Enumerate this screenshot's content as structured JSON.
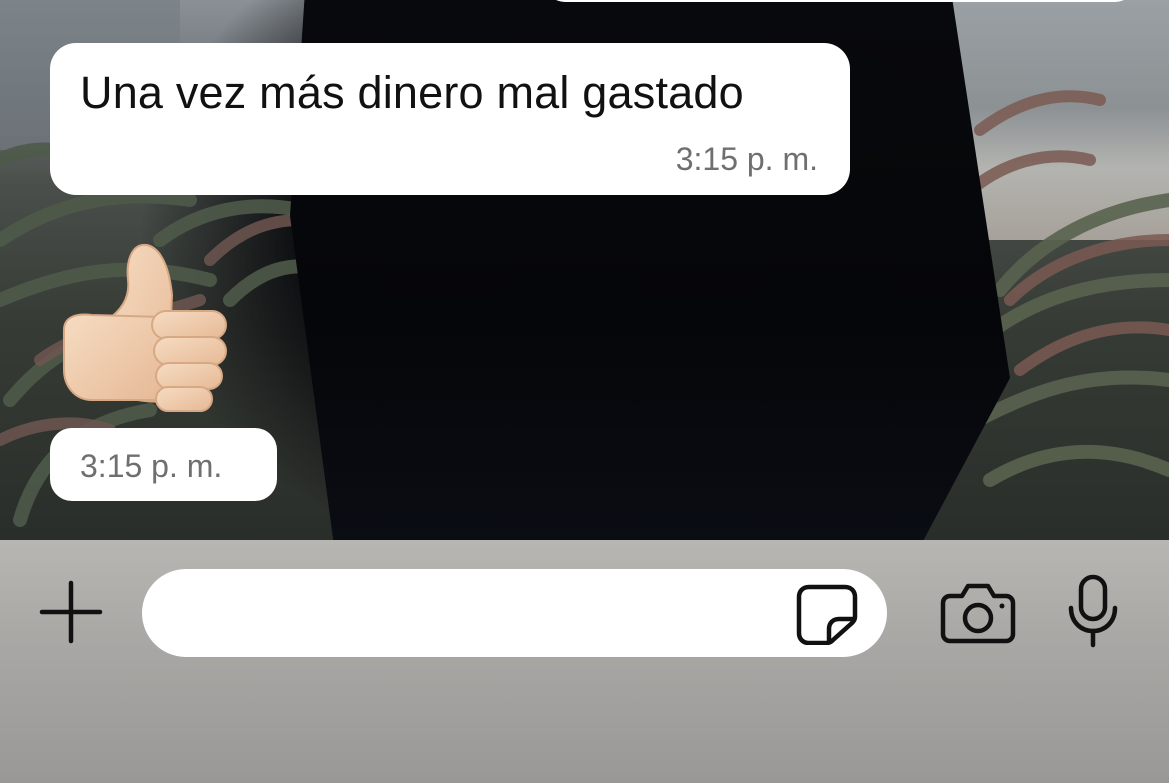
{
  "chat": {
    "messages": [
      {
        "type": "text",
        "text": "Una vez más dinero mal gastado",
        "time": "3:15 p. m."
      },
      {
        "type": "emoji",
        "emoji": "thumbs-up-light-skin-tone",
        "time": "3:15 p. m."
      }
    ],
    "wallpaper": "photo-person-among-aloe-plants-by-ocean"
  },
  "composer": {
    "input_value": "",
    "icons": {
      "attach": "plus-icon",
      "sticker": "sticker-icon",
      "camera": "camera-icon",
      "mic": "microphone-icon"
    }
  },
  "colors": {
    "bubble": "#ffffff",
    "time_text": "#6f6f6f",
    "composer_bar": "#a9a8a5",
    "icon": "#111111"
  }
}
